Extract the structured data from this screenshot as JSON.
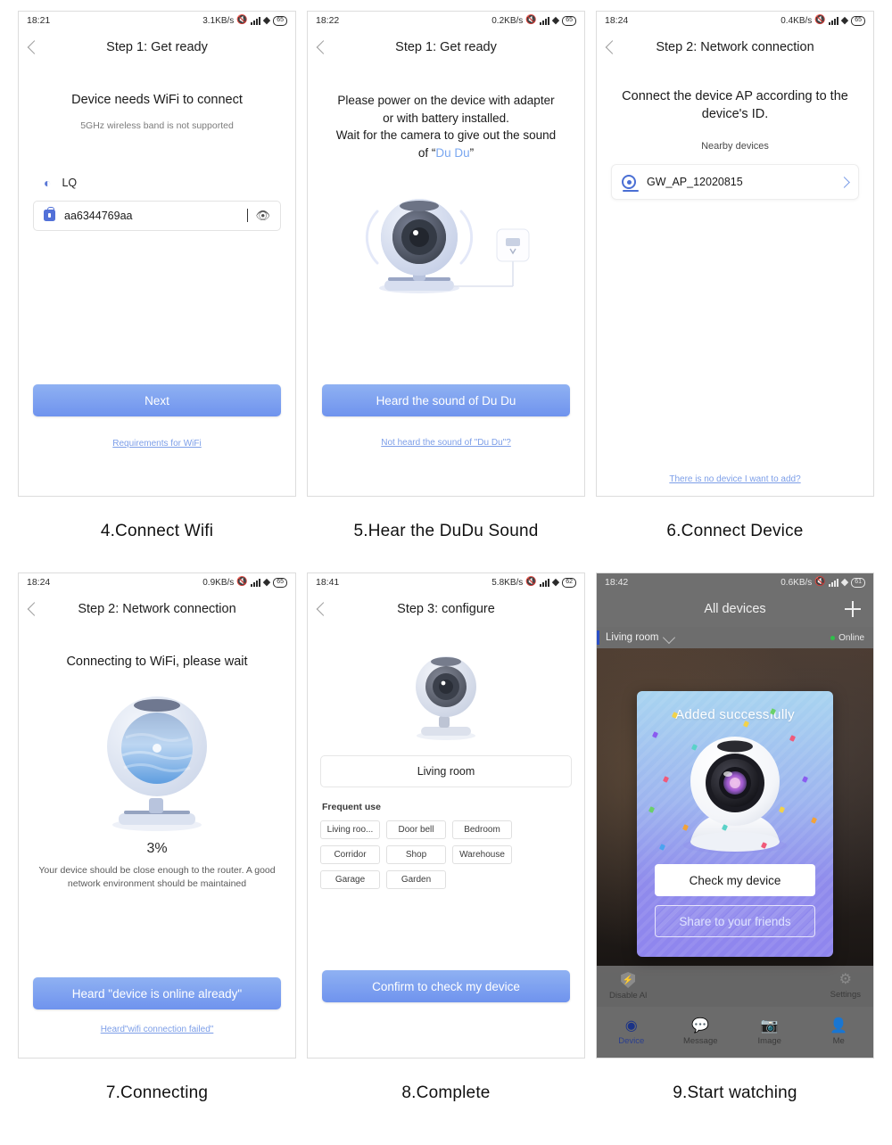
{
  "panels": [
    {
      "caption": "4.Connect Wifi",
      "status": {
        "time": "18:21",
        "speed": "3.1KB/s",
        "battery": "65"
      },
      "nav_title": "Step 1: Get ready",
      "headline": "Device needs WiFi to connect",
      "subnote": "5GHz wireless band is not supported",
      "wifi_ssid": "LQ",
      "password_value": "aa6344769aa",
      "primary_label": "Next",
      "link_label": "Requirements for WiFi"
    },
    {
      "caption": "5.Hear the DuDu Sound",
      "status": {
        "time": "18:22",
        "speed": "0.2KB/s",
        "battery": "65"
      },
      "nav_title": "Step 1: Get ready",
      "body_line1": "Please power on the device with adapter",
      "body_line2": "or with battery installed.",
      "body_line3": "Wait for the camera to give out the sound",
      "body_line4_prefix": "of “",
      "body_line4_accent": "Du Du",
      "body_line4_suffix": "”",
      "primary_label": "Heard the sound of Du Du",
      "link_label": "Not heard the sound of \"Du Du\"?"
    },
    {
      "caption": "6.Connect Device",
      "status": {
        "time": "18:24",
        "speed": "0.4KB/s",
        "battery": "65"
      },
      "nav_title": "Step 2: Network connection",
      "headline": "Connect the device AP according to the device's ID.",
      "section_label": "Nearby devices",
      "device_name": "GW_AP_12020815",
      "link_label": "There is no device I want to add?"
    },
    {
      "caption": "7.Connecting",
      "status": {
        "time": "18:24",
        "speed": "0.9KB/s",
        "battery": "65"
      },
      "nav_title": "Step 2: Network connection",
      "headline": "Connecting to WiFi, please wait",
      "progress": "3%",
      "hint": "Your device should be close enough to the router. A good network environment should be maintained",
      "primary_label": "Heard \"device is online already\"",
      "link_label": "Heard\"wifi connection failed\""
    },
    {
      "caption": "8.Complete",
      "status": {
        "time": "18:41",
        "speed": "5.8KB/s",
        "battery": "62"
      },
      "nav_title": "Step 3: configure",
      "name_value": "Living room",
      "frequent_label": "Frequent use",
      "chips": [
        "Living roo...",
        "Door bell",
        "Bedroom",
        "Corridor",
        "Shop",
        "Warehouse",
        "Garage",
        "Garden"
      ],
      "primary_label": "Confirm to check my device"
    },
    {
      "caption": "9.Start watching",
      "status": {
        "time": "18:42",
        "speed": "0.6KB/s",
        "battery": "61"
      },
      "nav_title": "All devices",
      "room_name": "Living room",
      "online_label": "Online",
      "toolbar": [
        {
          "label": "Disable Al",
          "icon": "shield-icon"
        },
        {
          "label": "Settings",
          "icon": "gear-icon"
        }
      ],
      "dialog": {
        "title": "Added successfully",
        "primary_label": "Check my device",
        "secondary_label": "Share to your friends"
      },
      "tabs": [
        {
          "label": "Device",
          "icon": "camera-icon",
          "active": true
        },
        {
          "label": "Message",
          "icon": "chat-icon",
          "active": false
        },
        {
          "label": "Image",
          "icon": "photo-icon",
          "active": false
        },
        {
          "label": "Me",
          "icon": "person-icon",
          "active": false
        }
      ]
    }
  ],
  "colors": {
    "accent_blue": "#7aa7f0",
    "button_blue": "#6f93ee",
    "link_blue": "#7c9ee8",
    "online_green": "#2fbf4a"
  }
}
